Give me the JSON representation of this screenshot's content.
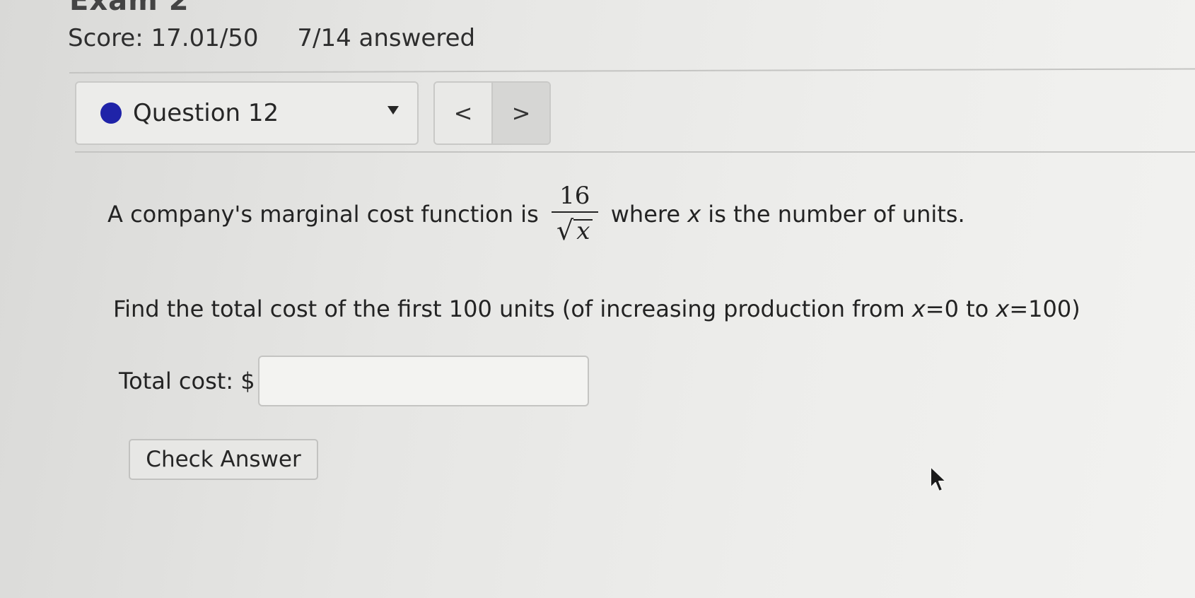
{
  "header": {
    "title": "Exam 2",
    "score": "Score: 17.01/50",
    "answered": "7/14 answered"
  },
  "question_nav": {
    "selected": "Question 12",
    "status_color": "#1f23a8",
    "prev_symbol": "<",
    "next_symbol": ">"
  },
  "question": {
    "intro": "A company's marginal cost function is",
    "numerator": "16",
    "radical": "√",
    "radicand": "x",
    "after_fraction_1": "where",
    "variable": "x",
    "after_fraction_2": "is the number of units.",
    "find_prefix": "Find the total cost of the first 100 units (of increasing production from",
    "find_bound1_var": "x",
    "find_bound1_val": "=0 to",
    "find_bound2_var": "x",
    "find_bound2_val": "=100)"
  },
  "answer": {
    "label": "Total cost: $",
    "value": "",
    "placeholder": ""
  },
  "actions": {
    "check_label": "Check Answer"
  }
}
